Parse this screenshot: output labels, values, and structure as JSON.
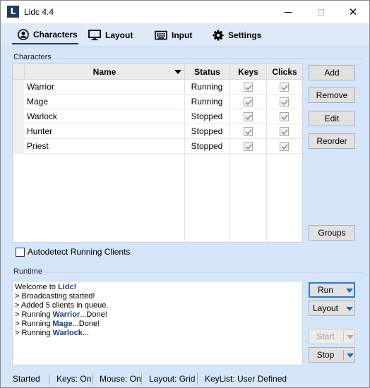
{
  "window": {
    "title": "Lidc 4.4",
    "icon_letter": "L"
  },
  "tabs": [
    {
      "label": "Characters",
      "icon": "person-circle-icon",
      "active": true
    },
    {
      "label": "Layout",
      "icon": "monitor-icon",
      "active": false
    },
    {
      "label": "Input",
      "icon": "keyboard-icon",
      "active": false
    },
    {
      "label": "Settings",
      "icon": "gear-icon",
      "active": false
    }
  ],
  "characters_group": {
    "label": "Characters",
    "columns": {
      "name": "Name",
      "status": "Status",
      "keys": "Keys",
      "clicks": "Clicks"
    },
    "rows": [
      {
        "name": "Warrior",
        "status": "Running",
        "keys": true,
        "clicks": true
      },
      {
        "name": "Mage",
        "status": "Running",
        "keys": true,
        "clicks": true
      },
      {
        "name": "Warlock",
        "status": "Stopped",
        "keys": true,
        "clicks": true
      },
      {
        "name": "Hunter",
        "status": "Stopped",
        "keys": true,
        "clicks": true
      },
      {
        "name": "Priest",
        "status": "Stopped",
        "keys": true,
        "clicks": true
      }
    ],
    "buttons": {
      "add": "Add",
      "remove": "Remove",
      "edit": "Edit",
      "reorder": "Reorder",
      "groups": "Groups"
    },
    "autodetect_label": "Autodetect Running Clients",
    "autodetect_checked": false
  },
  "runtime_group": {
    "label": "Runtime",
    "log": [
      {
        "prefix": "Welcome to ",
        "bold": "Lidc!",
        "suffix": ""
      },
      {
        "prefix": "> Broadcasting started!",
        "bold": "",
        "suffix": ""
      },
      {
        "prefix": "> Added 5 clients in queue.",
        "bold": "",
        "suffix": ""
      },
      {
        "prefix": "> Running ",
        "bold": "Warrior",
        "suffix": "...Done!"
      },
      {
        "prefix": "> Running ",
        "bold": "Mage",
        "suffix": "...Done!"
      },
      {
        "prefix": "> Running ",
        "bold": "Warlock",
        "suffix": "..."
      }
    ],
    "buttons": {
      "run": "Run",
      "layout": "Layout",
      "start": "Start",
      "stop": "Stop"
    }
  },
  "statusbar": {
    "state": "Started",
    "keys": "Keys: On",
    "mouse": "Mouse: On",
    "layout": "Layout: Grid",
    "keylist": "KeyList: User Defined"
  },
  "colors": {
    "accent": "#1f3b63",
    "client_bg": "#d5e5fa",
    "link_bold": "#1f3b86",
    "split_arrow": "#2468c5"
  }
}
